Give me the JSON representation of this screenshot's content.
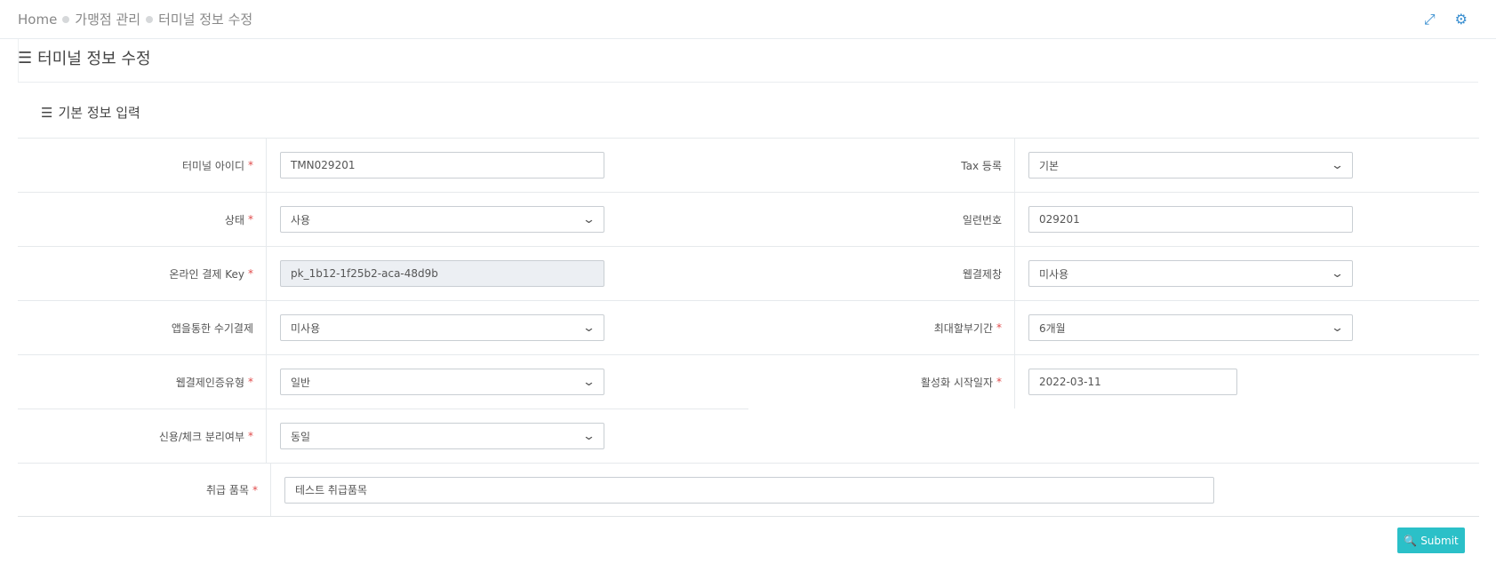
{
  "breadcrumb": [
    "Home",
    "가맹점 관리",
    "터미널 정보 수정"
  ],
  "page_title": "터미널 정보 수정",
  "section_title": "기본 정보 입력",
  "form": {
    "terminal_id": {
      "label": "터미널 아이디",
      "value": "TMN029201",
      "required": "*"
    },
    "tax": {
      "label": "Tax 등록",
      "value": "기본"
    },
    "status": {
      "label": "상태",
      "value": "사용",
      "required": "*"
    },
    "serial": {
      "label": "일련번호",
      "value": "029201"
    },
    "online_key": {
      "label": "온라인 결제 Key",
      "value": "pk_1b12-1f25b2-aca-48d9b",
      "required": "*"
    },
    "web_window": {
      "label": "웹결제창",
      "value": "미사용"
    },
    "app_manual": {
      "label": "앱을통한 수기결제",
      "value": "미사용"
    },
    "max_installment": {
      "label": "최대할부기간",
      "value": "6개월",
      "required": "*"
    },
    "web_auth_type": {
      "label": "웹결제인증유형",
      "value": "일반",
      "required": "*"
    },
    "activation_date": {
      "label": "활성화 시작일자",
      "value": "2022-03-11",
      "required": "*"
    },
    "credit_check": {
      "label": "신용/체크 분리여부",
      "value": "동일",
      "required": "*"
    },
    "products": {
      "label": "취급 품목",
      "value": "테스트 취급품목",
      "required": "*"
    }
  },
  "submit_label": "Submit",
  "icons": {
    "fullscreen": "expand-icon",
    "settings": "gear-icon",
    "menu": "hamburger-icon",
    "search": "search-icon"
  }
}
